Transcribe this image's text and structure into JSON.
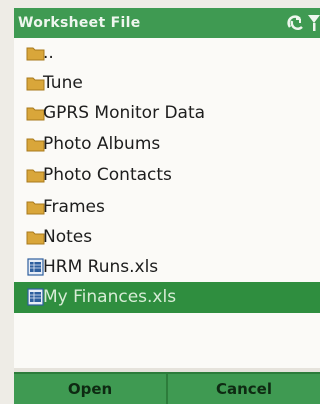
{
  "window": {
    "title": "Worksheet File"
  },
  "files": [
    {
      "label": "..",
      "type": "folder"
    },
    {
      "label": "Tune",
      "type": "folder"
    },
    {
      "label": "GPRS Monitor Data",
      "type": "folder"
    },
    {
      "label": "Photo Albums",
      "type": "folder"
    },
    {
      "label": "Photo Contacts",
      "type": "folder"
    },
    {
      "label": "Frames",
      "type": "folder"
    },
    {
      "label": "Notes",
      "type": "folder"
    },
    {
      "label": "HRM Runs.xls",
      "type": "file"
    },
    {
      "label": "My Finances.xls",
      "type": "file",
      "selected": true
    }
  ],
  "softkeys": {
    "left": "Open",
    "right": "Cancel"
  },
  "colors": {
    "accent": "#3f9a52",
    "selected": "#2f8e3f",
    "folder": "#d9a63a",
    "file_icon": "#2e5f9e"
  }
}
